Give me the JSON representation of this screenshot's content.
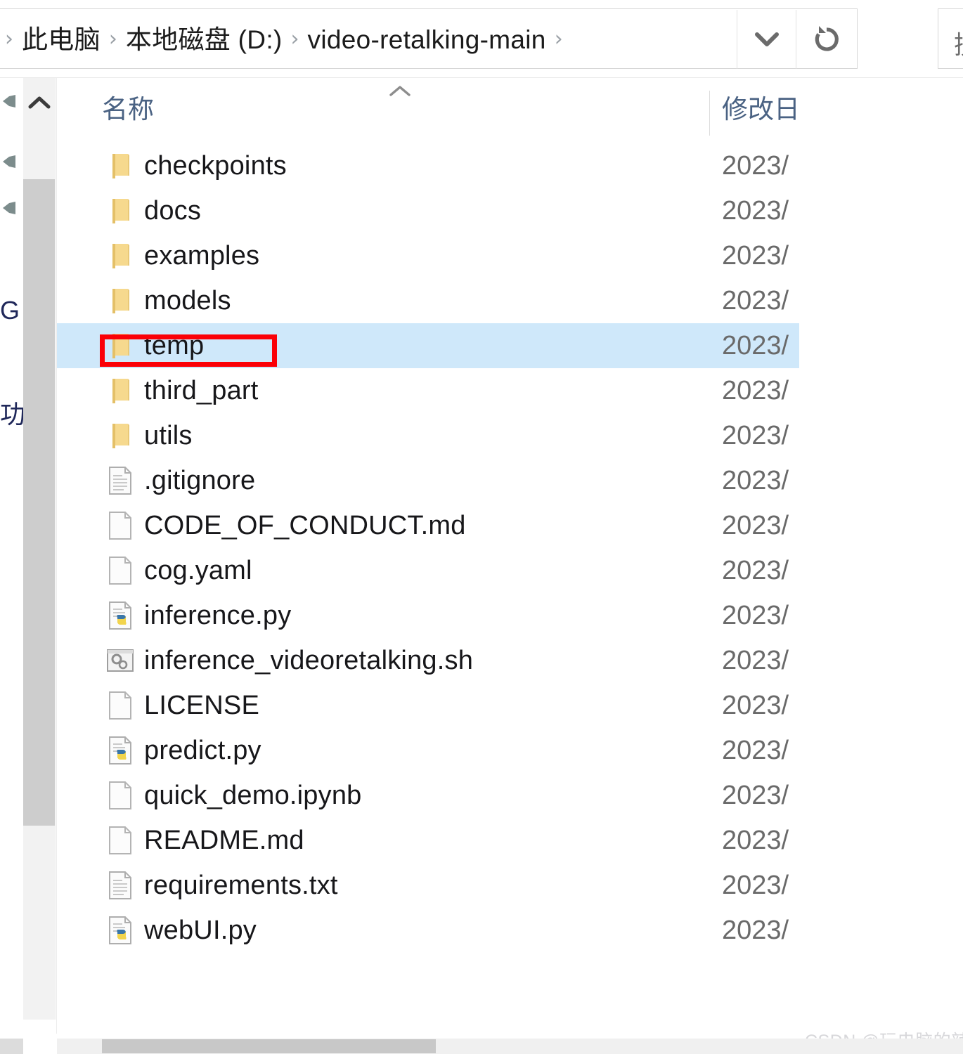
{
  "window": {
    "address_bar": {
      "breadcrumbs": [
        "此电脑",
        "本地磁盘 (D:)",
        "video-retalking-main"
      ],
      "separator": "›",
      "dropdown_icon": "chevron-down-icon",
      "refresh_icon": "refresh-icon"
    },
    "search": {
      "placeholder_visible": "搜"
    }
  },
  "nav_pane": {
    "scroll_up_icon": "chevron-up-icon",
    "pin_icon": "pin-icon",
    "text_fragments": [
      "G",
      "功"
    ]
  },
  "file_list": {
    "sort_indicator": "chevron-up-icon",
    "columns": [
      {
        "key": "name",
        "label": "名称"
      },
      {
        "key": "date",
        "label": "修改日"
      }
    ],
    "rows": [
      {
        "name": "checkpoints",
        "date": "2023/",
        "icon": "folder-icon",
        "selected": false
      },
      {
        "name": "docs",
        "date": "2023/",
        "icon": "folder-icon",
        "selected": false
      },
      {
        "name": "examples",
        "date": "2023/",
        "icon": "folder-icon",
        "selected": false
      },
      {
        "name": "models",
        "date": "2023/",
        "icon": "folder-icon",
        "selected": false
      },
      {
        "name": "temp",
        "date": "2023/",
        "icon": "folder-icon",
        "selected": true
      },
      {
        "name": "third_part",
        "date": "2023/",
        "icon": "folder-icon",
        "selected": false
      },
      {
        "name": "utils",
        "date": "2023/",
        "icon": "folder-icon",
        "selected": false
      },
      {
        "name": ".gitignore",
        "date": "2023/",
        "icon": "text-file-icon",
        "selected": false
      },
      {
        "name": "CODE_OF_CONDUCT.md",
        "date": "2023/",
        "icon": "blank-file-icon",
        "selected": false
      },
      {
        "name": "cog.yaml",
        "date": "2023/",
        "icon": "blank-file-icon",
        "selected": false
      },
      {
        "name": "inference.py",
        "date": "2023/",
        "icon": "python-file-icon",
        "selected": false
      },
      {
        "name": "inference_videoretalking.sh",
        "date": "2023/",
        "icon": "shell-script-icon",
        "selected": false
      },
      {
        "name": "LICENSE",
        "date": "2023/",
        "icon": "blank-file-icon",
        "selected": false
      },
      {
        "name": "predict.py",
        "date": "2023/",
        "icon": "python-file-icon",
        "selected": false
      },
      {
        "name": "quick_demo.ipynb",
        "date": "2023/",
        "icon": "blank-file-icon",
        "selected": false
      },
      {
        "name": "README.md",
        "date": "2023/",
        "icon": "blank-file-icon",
        "selected": false
      },
      {
        "name": "requirements.txt",
        "date": "2023/",
        "icon": "text-file-icon",
        "selected": false
      },
      {
        "name": "webUI.py",
        "date": "2023/",
        "icon": "python-file-icon",
        "selected": false
      }
    ]
  },
  "annotation": {
    "type": "rectangle-highlight",
    "target": "temp",
    "color": "#fb0007"
  },
  "watermark": {
    "text": "CSDN @玩电脑的辣条哥"
  },
  "colors": {
    "selection": "#cfe8fa",
    "annotation": "#fb0007",
    "header_text": "#4a6283",
    "folder": "#f4d488"
  }
}
